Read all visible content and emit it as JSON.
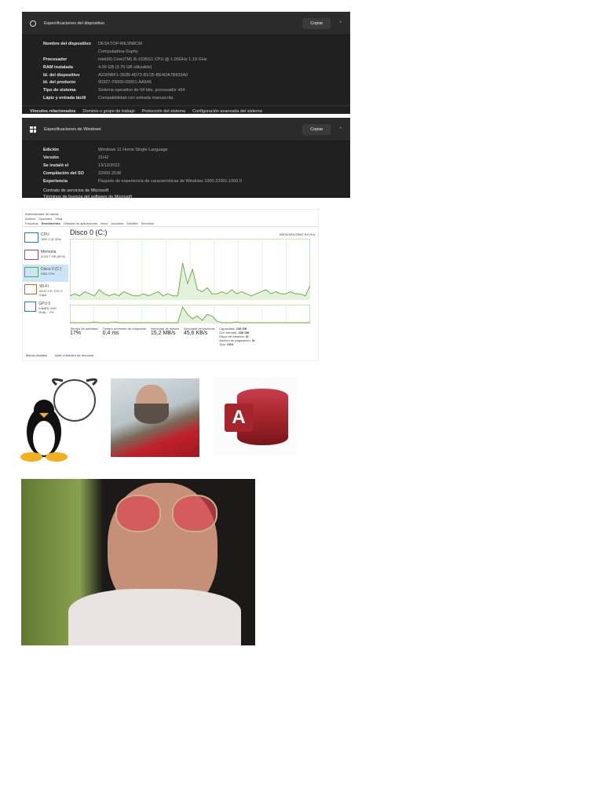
{
  "device_specs": {
    "title": "Especificaciones del dispositivo",
    "copy_label": "Copiar",
    "rows": [
      {
        "k": "Nombre del dispositivo",
        "v": "DESKTOP-MIL9N8CM"
      },
      {
        "k": "",
        "v": "Computadora-Sophy"
      },
      {
        "k": "Procesador",
        "v": "Intel(R) Core(TM) i5-1035G1 CPU @ 1.00GHz   1.19 GHz"
      },
      {
        "k": "RAM instalada",
        "v": "4.00 GB (3.70 GB utilizable)"
      },
      {
        "k": "Id. del dispositivo",
        "v": "A2005BF1-392B-4D73-B1CB-BE4DA7B833A0"
      },
      {
        "k": "Id. del producto",
        "v": "00327-70000-00001-AA646"
      },
      {
        "k": "Tipo de sistema",
        "v": "Sistema operativo de 64 bits, procesador x64"
      },
      {
        "k": "Lápiz y entrada táctil",
        "v": "Compatibilidad con entrada manuscrita"
      }
    ],
    "links_label": "Vínculos relacionados",
    "links": [
      "Dominio o grupo de trabajo",
      "Protección del sistema",
      "Configuración avanzada del sistema"
    ]
  },
  "windows_specs": {
    "title": "Especificaciones de Windows",
    "copy_label": "Copiar",
    "rows": [
      {
        "k": "Edición",
        "v": "Windows 11 Home Single Language"
      },
      {
        "k": "Versión",
        "v": "21H2"
      },
      {
        "k": "Se instaló el",
        "v": "13/12/2022"
      },
      {
        "k": "Compilación del SO",
        "v": "22000.2538"
      },
      {
        "k": "Experiencia",
        "v": "Paquete de experiencia de características de Windows 1000.22001.1000.0"
      }
    ],
    "link1": "Contrato de servicios de Microsoft",
    "link2": "Términos de licencia del software de Microsoft"
  },
  "task_manager": {
    "title": "Administrador de tareas",
    "menu": [
      "Archivo",
      "Opciones",
      "Vista"
    ],
    "tabs": [
      "Procesos",
      "Rendimiento",
      "Historial de aplicaciones",
      "Inicio",
      "Usuarios",
      "Detalles",
      "Servicios"
    ],
    "side": [
      {
        "name": "CPU",
        "sub": "18% 1,32 GHz",
        "color": "#1a7fd0"
      },
      {
        "name": "Memoria",
        "sub": "3,0/3,7 GB (81%)",
        "color": "#a040b0"
      },
      {
        "name": "Disco 0 (C:)",
        "sub": "SSD 17%",
        "color": "#4caf50"
      },
      {
        "name": "Wi-Fi",
        "sub": "Wi-Fi 2 E: 0 R: 0 Kbps",
        "color": "#b07030"
      },
      {
        "name": "GPU 0",
        "sub": "Intel(R) UHD Grap... 2%",
        "color": "#1a7fd0"
      }
    ],
    "disk_title": "Disco 0 (C:)",
    "disk_model": "KBG40ZNV256G KIOXIA",
    "stats": [
      {
        "k": "Tiempo de actividad",
        "v": "17%"
      },
      {
        "k": "Tiempo promedio de respuesta",
        "v": "0,4 ms"
      },
      {
        "k": "Velocidad de lectura",
        "v": "15,2 MB/s"
      },
      {
        "k": "Velocidad de escritura",
        "v": "45,6 KB/s"
      }
    ],
    "props": [
      [
        "Capacidad:",
        "238 GB"
      ],
      [
        "Con formato:",
        "238 GB"
      ],
      [
        "Disco del sistema:",
        "Sí"
      ],
      [
        "Archivo de paginación:",
        "Sí"
      ],
      [
        "Tipo:",
        "SSD"
      ]
    ],
    "footer": [
      "Menos detalles",
      "Abrir el Monitor de recursos"
    ],
    "activity": [
      2,
      3,
      2,
      4,
      3,
      2,
      5,
      3,
      2,
      3,
      2,
      4,
      3,
      2,
      2,
      3,
      2,
      3,
      4,
      2,
      3,
      2,
      2,
      18,
      8,
      15,
      5,
      4,
      6,
      3,
      3,
      4,
      3,
      5,
      3,
      4,
      3,
      2,
      3,
      4,
      5,
      3,
      4,
      3,
      3,
      4,
      3,
      3,
      2,
      7
    ],
    "transfer": [
      1,
      1,
      1,
      1,
      1,
      2,
      1,
      1,
      1,
      2,
      1,
      1,
      1,
      1,
      1,
      1,
      1,
      1,
      1,
      1,
      1,
      1,
      1,
      22,
      12,
      6,
      10,
      4,
      12,
      10,
      3,
      1,
      1,
      1,
      2,
      1,
      1,
      1,
      1,
      1,
      1,
      1,
      1,
      1,
      1,
      1,
      1,
      1,
      1,
      1
    ]
  }
}
